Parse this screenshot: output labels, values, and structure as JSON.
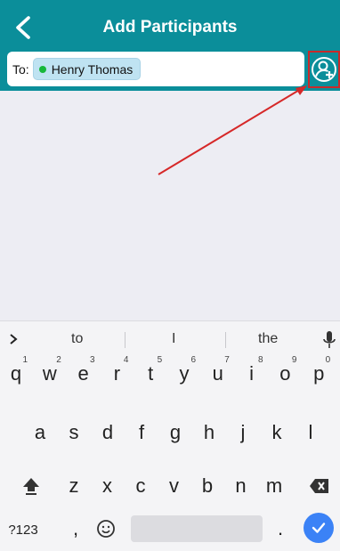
{
  "header": {
    "title": "Add Participants",
    "to_label": "To:",
    "participant": {
      "name": "Henry Thomas",
      "status_color": "#17b83b"
    }
  },
  "colors": {
    "header_bg": "#0b8e9a",
    "annotation": "#c82a2a",
    "enter": "#3b82f6"
  },
  "keyboard": {
    "suggestions": [
      "to",
      "I",
      "the"
    ],
    "row1": [
      {
        "k": "q",
        "h": "1"
      },
      {
        "k": "w",
        "h": "2"
      },
      {
        "k": "e",
        "h": "3"
      },
      {
        "k": "r",
        "h": "4"
      },
      {
        "k": "t",
        "h": "5"
      },
      {
        "k": "y",
        "h": "6"
      },
      {
        "k": "u",
        "h": "7"
      },
      {
        "k": "i",
        "h": "8"
      },
      {
        "k": "o",
        "h": "9"
      },
      {
        "k": "p",
        "h": "0"
      }
    ],
    "row2": [
      "a",
      "s",
      "d",
      "f",
      "g",
      "h",
      "j",
      "k",
      "l"
    ],
    "row3": [
      "z",
      "x",
      "c",
      "v",
      "b",
      "n",
      "m"
    ],
    "sym_label": "?123",
    "comma": ",",
    "period": "."
  }
}
